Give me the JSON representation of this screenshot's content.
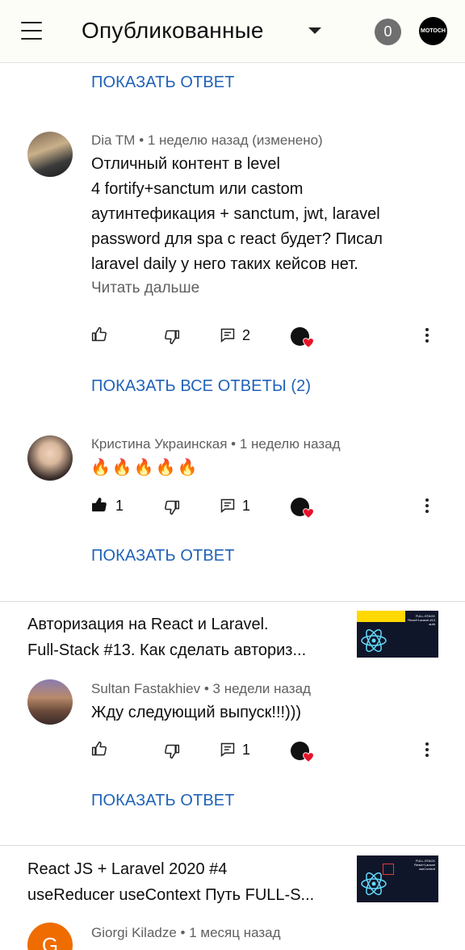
{
  "header": {
    "title": "Опубликованные",
    "notification_count": "0",
    "channel_avatar_text": "MOTOCH",
    "colors": {
      "background": "#fdfdf8",
      "badge": "#6f6f6f"
    }
  },
  "links": {
    "show_reply_1": "ПОКАЗАТЬ ОТВЕТ",
    "show_all_replies": "ПОКАЗАТЬ ВСЕ ОТВЕТЫ (2)",
    "show_reply_2": "ПОКАЗАТЬ ОТВЕТ",
    "show_reply_3": "ПОКАЗАТЬ ОТВЕТ"
  },
  "comments": [
    {
      "author_meta": "Dia TM • 1 неделю назад (изменено)",
      "lines": [
        "Отличный контент в level",
        "4  fortify+sanctum или castom",
        "аутинтефикация + sanctum, jwt, laravel",
        "password для spa с react будет? Писал",
        "laravel daily у него таких кейсов нет."
      ],
      "read_more": "Читать дальше",
      "likes": "",
      "replies": "2"
    },
    {
      "author_meta": "Кристина Украинская • 1 неделю назад",
      "text": "🔥🔥🔥🔥🔥",
      "likes": "1",
      "replies": "1"
    },
    {
      "author_meta": "Sultan Fastakhiev • 3 недели назад",
      "text": "Жду следующий выпуск!!!)))",
      "likes": "",
      "replies": "1"
    },
    {
      "author_meta": "Giorgi Kiladze • 1 месяц назад",
      "avatar_letter": "G"
    }
  ],
  "videos": [
    {
      "title_line1": "Авторизация на React и Laravel.",
      "title_line2": "Full-Stack #13. Как сделать авториз...",
      "thumb_text": "FULL-STACK React+Laravel #13 auth"
    },
    {
      "title_line1": "React JS + Laravel 2020 #4",
      "title_line2": "useReducer useContext Путь FULL-S...",
      "thumb_text": "FULL-STACK React+Laravel useContext"
    }
  ],
  "icons": [
    "menu-icon",
    "dropdown-icon",
    "thumbs-up-icon",
    "thumbs-down-icon",
    "reply-icon",
    "heart-icon",
    "more-icon"
  ]
}
